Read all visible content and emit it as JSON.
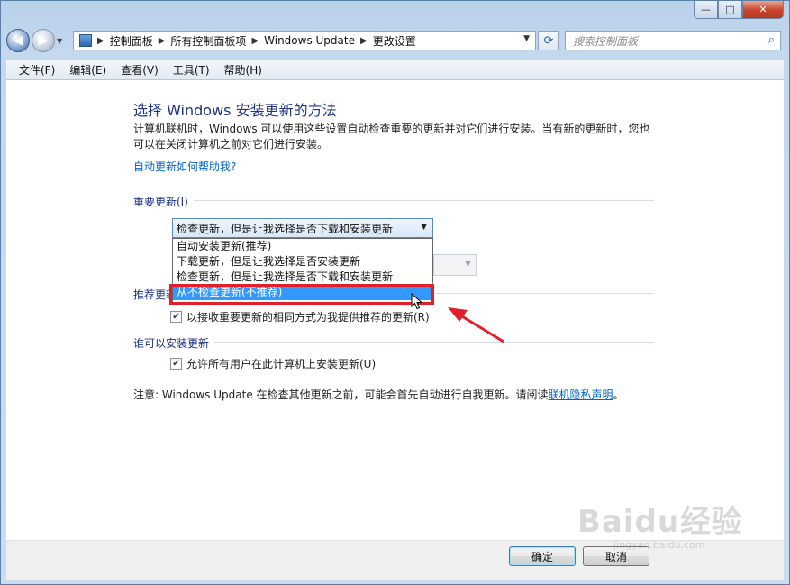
{
  "window": {
    "caption_buttons": {
      "minimize": "—",
      "maximize": "□",
      "close": "✕"
    }
  },
  "nav": {
    "back_icon": "back-arrow-icon",
    "forward_icon": "forward-arrow-icon",
    "breadcrumbs": [
      "控制面板",
      "所有控制面板项",
      "Windows Update",
      "更改设置"
    ],
    "search_placeholder": "搜索控制面板"
  },
  "menu": {
    "items": [
      "文件(F)",
      "编辑(E)",
      "查看(V)",
      "工具(T)",
      "帮助(H)"
    ]
  },
  "content": {
    "heading": "选择 Windows 安装更新的方法",
    "description": "计算机联机时，Windows 可以使用这些设置自动检查重要的更新并对它们进行安装。当有新的更新时，您也可以在关闭计算机之前对它们进行安装。",
    "help_link": "自动更新如何帮助我?",
    "important_updates": {
      "label": "重要更新(I)",
      "selected": "检查更新，但是让我选择是否下载和安装更新",
      "options": [
        "自动安装更新(推荐)",
        "下载更新，但是让我选择是否安装更新",
        "检查更新，但是让我选择是否下载和安装更新",
        "从不检查更新(不推荐)"
      ],
      "highlighted_option_index": 3
    },
    "recommended_updates": {
      "label": "推荐更新",
      "checkbox_label": "以接收重要更新的相同方式为我提供推荐的更新(R)",
      "checked": true
    },
    "who_can_install": {
      "label": "谁可以安装更新",
      "checkbox_label": "允许所有用户在此计算机上安装更新(U)",
      "checked": true
    },
    "note_prefix": "注意: Windows Update 在检查其他更新之前，可能会首先自动进行自我更新。请阅读",
    "note_link": "联机隐私声明",
    "note_suffix": "。"
  },
  "footer": {
    "ok": "确定",
    "cancel": "取消"
  },
  "watermark": {
    "brand": "Baidu经验",
    "url": "jingyan.baidu.com"
  },
  "colors": {
    "annotation_red": "#e0202a",
    "selection_blue": "#3399ff",
    "link_blue": "#0066cc",
    "heading_blue": "#1e3287"
  }
}
